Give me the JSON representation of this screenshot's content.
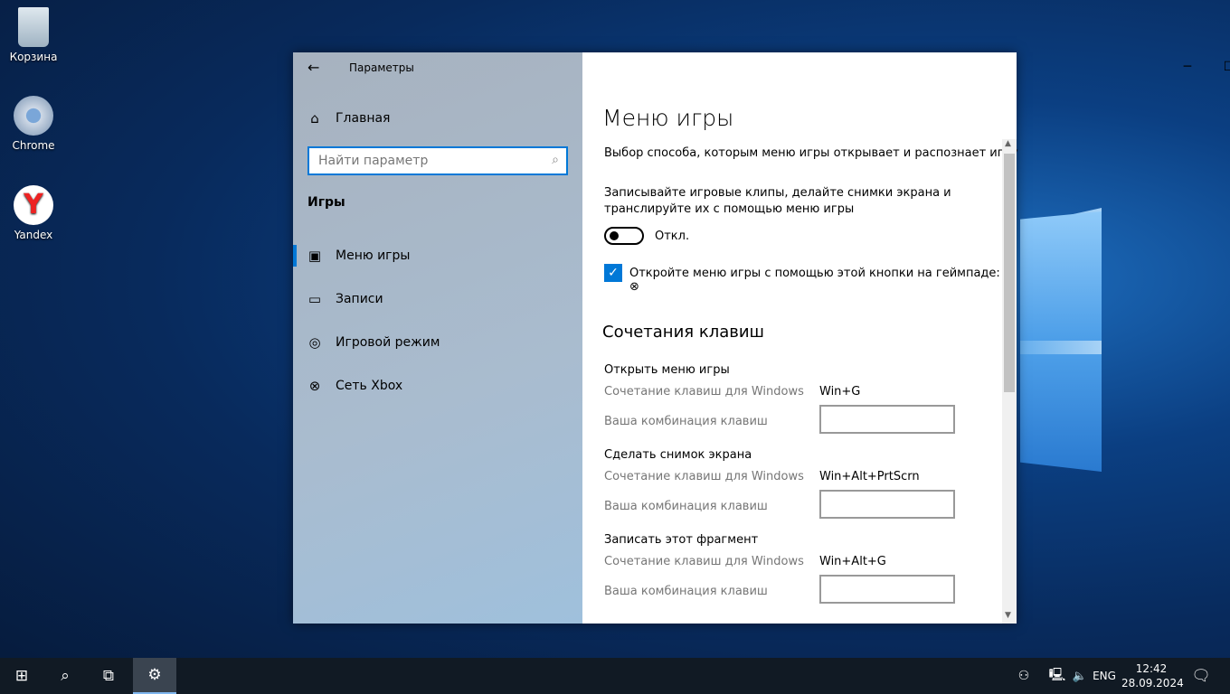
{
  "desktop": {
    "icons": [
      {
        "label": "Корзина",
        "icon": "recycle-bin-icon"
      },
      {
        "label": "Chrome",
        "icon": "chrome-icon"
      },
      {
        "label": "Yandex",
        "icon": "yandex-icon"
      }
    ]
  },
  "window": {
    "app_title": "Параметры",
    "sidebar": {
      "home": "Главная",
      "search_placeholder": "Найти параметр",
      "section": "Игры",
      "items": [
        {
          "label": "Меню игры",
          "icon": "game-bar-icon",
          "selected": true
        },
        {
          "label": "Записи",
          "icon": "captures-icon"
        },
        {
          "label": "Игровой режим",
          "icon": "game-mode-icon"
        },
        {
          "label": "Сеть Xbox",
          "icon": "xbox-icon"
        }
      ]
    },
    "main": {
      "title": "Меню игры",
      "subtitle": "Выбор способа, которым меню игры открывает и распознает игру",
      "record_desc_1": "Записывайте игровые клипы, делайте снимки экрана и",
      "record_desc_2": "транслируйте их с помощью меню игры",
      "toggle": {
        "state": "off",
        "label": "Откл."
      },
      "checkbox": {
        "checked": true,
        "label": "Откройте меню игры с помощью этой кнопки на геймпаде:"
      },
      "shortcuts_title": "Сочетания клавиш",
      "shortcuts": [
        {
          "name": "Открыть меню игры",
          "win_label": "Сочетание клавиш для Windows",
          "win_value": "Win+G",
          "custom_label": "Ваша комбинация клавиш",
          "custom_value": ""
        },
        {
          "name": "Сделать снимок экрана",
          "win_label": "Сочетание клавиш для Windows",
          "win_value": "Win+Alt+PrtScrn",
          "custom_label": "Ваша комбинация клавиш",
          "custom_value": ""
        },
        {
          "name": "Записать этот фрагмент",
          "win_label": "Сочетание клавиш для Windows",
          "win_value": "Win+Alt+G",
          "custom_label": "Ваша комбинация клавиш",
          "custom_value": ""
        }
      ]
    }
  },
  "taskbar": {
    "lang": "ENG",
    "time": "12:42",
    "date": "28.09.2024"
  },
  "colors": {
    "accent": "#0078d7",
    "taskbar": "#111a24"
  }
}
